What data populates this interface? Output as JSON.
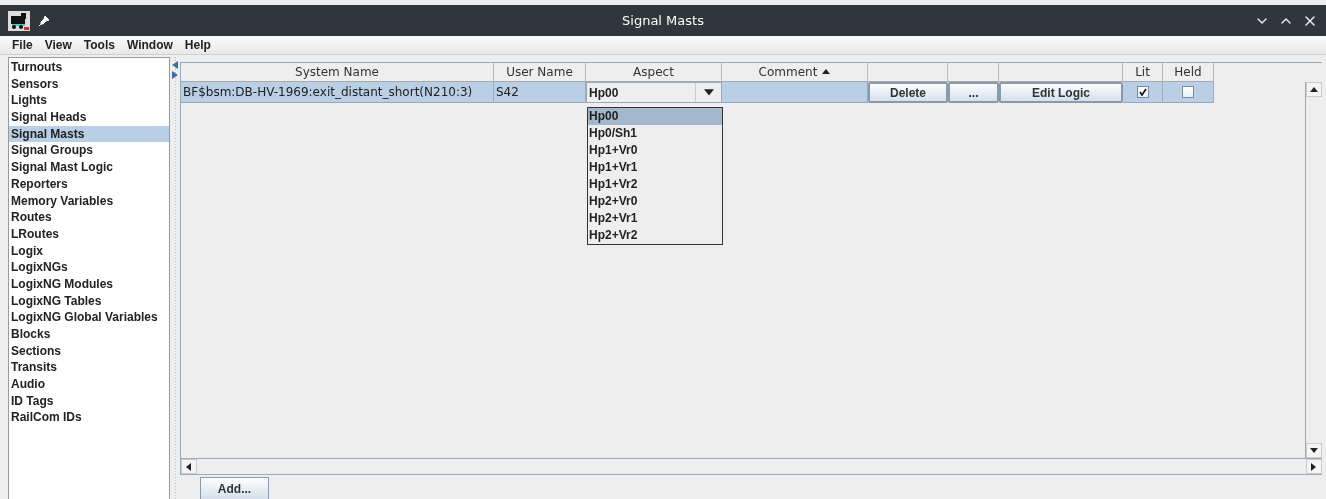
{
  "window": {
    "title": "Signal Masts"
  },
  "menu": [
    "File",
    "View",
    "Tools",
    "Window",
    "Help"
  ],
  "sidebar": {
    "items": [
      {
        "label": "Turnouts",
        "selected": false
      },
      {
        "label": "Sensors",
        "selected": false
      },
      {
        "label": "Lights",
        "selected": false
      },
      {
        "label": "Signal Heads",
        "selected": false
      },
      {
        "label": "Signal Masts",
        "selected": true
      },
      {
        "label": "Signal Groups",
        "selected": false
      },
      {
        "label": "Signal Mast Logic",
        "selected": false
      },
      {
        "label": "Reporters",
        "selected": false
      },
      {
        "label": "Memory Variables",
        "selected": false
      },
      {
        "label": "Routes",
        "selected": false
      },
      {
        "label": "LRoutes",
        "selected": false
      },
      {
        "label": "Logix",
        "selected": false
      },
      {
        "label": "LogixNGs",
        "selected": false
      },
      {
        "label": "LogixNG Modules",
        "selected": false
      },
      {
        "label": "LogixNG Tables",
        "selected": false
      },
      {
        "label": "LogixNG Global Variables",
        "selected": false
      },
      {
        "label": "Blocks",
        "selected": false
      },
      {
        "label": "Sections",
        "selected": false
      },
      {
        "label": "Transits",
        "selected": false
      },
      {
        "label": "Audio",
        "selected": false
      },
      {
        "label": "ID Tags",
        "selected": false
      },
      {
        "label": "RailCom IDs",
        "selected": false
      }
    ]
  },
  "table": {
    "columns": [
      {
        "label": "System Name",
        "sort_ascending": false
      },
      {
        "label": "User Name",
        "sort_ascending": false
      },
      {
        "label": "Aspect",
        "sort_ascending": false
      },
      {
        "label": "Comment",
        "sort_ascending": true
      },
      {
        "sort_ascending": false
      },
      {
        "sort_ascending": false
      },
      {
        "sort_ascending": false
      },
      {
        "label": "Lit",
        "sort_ascending": false
      },
      {
        "label": "Held",
        "sort_ascending": false
      }
    ],
    "rows": [
      {
        "system_name": "BF$bsm:DB-HV-1969:exit_distant_short(N210:3)",
        "user_name": "S42",
        "aspect": "Hp00",
        "delete": "Delete",
        "more": "...",
        "edit_logic": "Edit Logic",
        "lit": true,
        "held": false
      }
    ]
  },
  "aspect_dropdown": {
    "expanded": true,
    "options": [
      {
        "label": "Hp00",
        "selected": true
      },
      {
        "label": "Hp0/Sh1",
        "selected": false
      },
      {
        "label": "Hp1+Vr0",
        "selected": false
      },
      {
        "label": "Hp1+Vr1",
        "selected": false
      },
      {
        "label": "Hp1+Vr2",
        "selected": false
      },
      {
        "label": "Hp2+Vr0",
        "selected": false
      },
      {
        "label": "Hp2+Vr1",
        "selected": false
      },
      {
        "label": "Hp2+Vr2",
        "selected": false
      }
    ]
  },
  "add_button": "Add..."
}
